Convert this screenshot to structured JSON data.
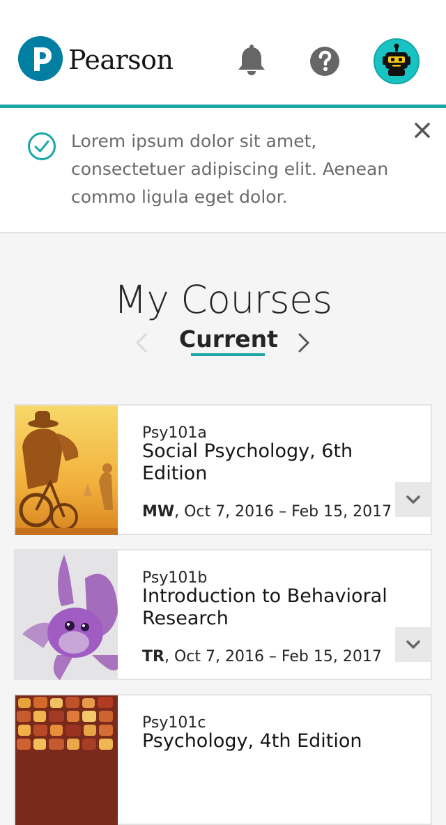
{
  "header": {
    "logo_text": "Pearson",
    "icons": [
      "bell-icon",
      "help-icon",
      "bot-avatar"
    ]
  },
  "alert": {
    "message": "Lorem ipsum dolor sit amet, consectetuer adipiscing elit. Aenean commo ligula eget dolor.",
    "icon": "check-circle-icon",
    "close_icon": "close-icon"
  },
  "main": {
    "title": "My Courses",
    "tab": "Current",
    "prev_icon": "chevron-left-icon",
    "next_icon": "chevron-right-icon"
  },
  "courses": [
    {
      "code": "Psy101a",
      "title": "Social Psychology, 6th Edition",
      "days": "MW",
      "dates": ", Oct 7, 2016 – Feb 15, 2017"
    },
    {
      "code": "Psy101b",
      "title": "Introduction to Behavioral Research",
      "days": "TR",
      "dates": ", Oct 7, 2016 – Feb 15, 2017"
    },
    {
      "code": "Psy101c",
      "title": "Psychology, 4th Edition",
      "days": "",
      "dates": ""
    }
  ],
  "colors": {
    "brand_blue": "#007fa3",
    "teal_accent": "#19a6a4",
    "bot_teal": "#19c3c3"
  }
}
